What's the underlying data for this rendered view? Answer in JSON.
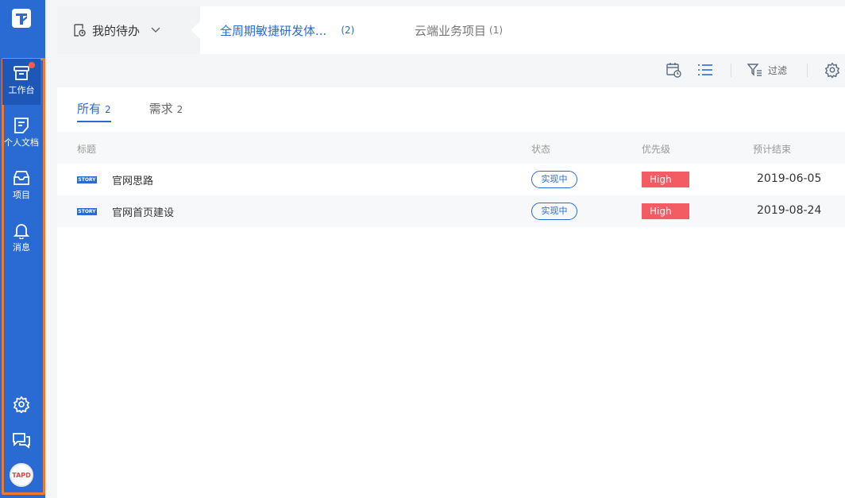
{
  "sidebar": {
    "logo": "T",
    "items": [
      {
        "label": "工作台",
        "icon": "archive-icon",
        "active": true
      },
      {
        "label": "个人文档",
        "icon": "document-icon",
        "active": false
      },
      {
        "label": "项目",
        "icon": "inbox-icon",
        "active": false
      },
      {
        "label": "消息",
        "icon": "bell-icon",
        "active": false
      }
    ],
    "avatar_text": "TAPD",
    "accent": "#2a6bd3"
  },
  "topbar": {
    "todo_label": "我的待办",
    "projects": [
      {
        "name": "全周期敏捷研发体...",
        "count": "(2)",
        "active": true
      },
      {
        "name": "云端业务项目",
        "count": "(1)",
        "active": false
      }
    ]
  },
  "toolbar": {
    "filter_label": "过滤"
  },
  "subtabs": [
    {
      "label": "所有",
      "count": "2",
      "active": true
    },
    {
      "label": "需求",
      "count": "2",
      "active": false
    }
  ],
  "table": {
    "columns": {
      "title": "标题",
      "status": "状态",
      "priority": "优先级",
      "due": "预计结束"
    },
    "rows": [
      {
        "tag": "STORY",
        "title": "官网思路",
        "status": "实现中",
        "priority": "High",
        "due": "2019-06-05"
      },
      {
        "tag": "STORY",
        "title": "官网首页建设",
        "status": "实现中",
        "priority": "High",
        "due": "2019-08-24"
      }
    ]
  },
  "colors": {
    "primary": "#2a6bd3",
    "high": "#f25c62",
    "highlight_frame": "#f07a34"
  }
}
